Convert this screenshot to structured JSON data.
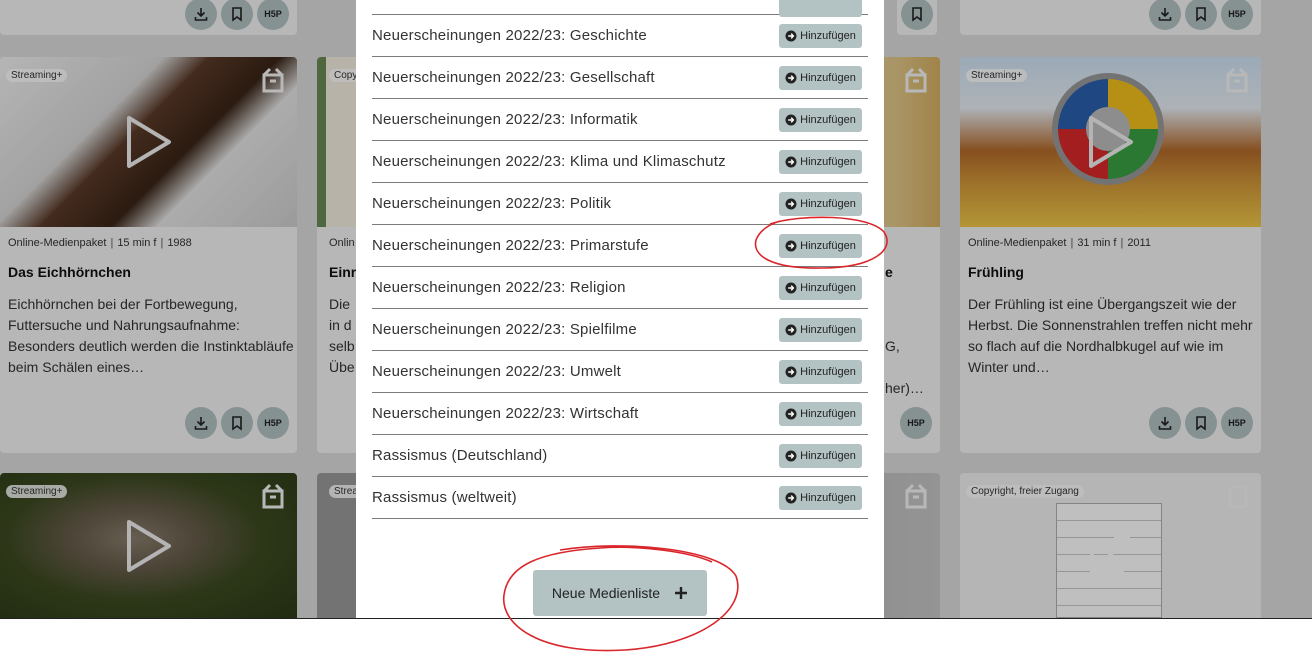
{
  "cards": [
    {
      "badge": "Streaming+",
      "meta": [
        "Online-Medienpaket",
        "15 min f",
        "1988"
      ],
      "title": "Das Eichhörnchen",
      "description": "Eichhörnchen bei der Fortbewegung, Futtersuche und Nahrungsaufnahme: Besonders deutlich werden die Instinktabläufe beim Schälen eines…",
      "actions": [
        "download",
        "bookmark",
        "H5P"
      ]
    },
    {
      "badge": "Copy",
      "meta_start": "Onlin",
      "title_partial": "Einr",
      "desc_partial": [
        "Die",
        "in d",
        "selb",
        "Übe"
      ]
    },
    {
      "title_partial": "e",
      "desc_partial": [
        "G,",
        "her)…"
      ],
      "actions": [
        "H5P"
      ]
    },
    {
      "badge": "Streaming+",
      "meta": [
        "Online-Medienpaket",
        "31 min f",
        "2011"
      ],
      "title": "Frühling",
      "description": "Der Frühling ist eine Übergangszeit wie der Herbst. Die Sonnenstrahlen treffen nicht mehr so flach auf die Nordhalbkugel auf wie im Winter und…",
      "actions": [
        "download",
        "bookmark",
        "H5P"
      ]
    }
  ],
  "bottom_cards": [
    {
      "badge": "Streaming+"
    },
    {
      "badge": "Strea"
    },
    {
      "badge": ""
    },
    {
      "badge": "Copyright, freier Zugang"
    }
  ],
  "modal": {
    "rows": [
      {
        "label": "Neuerscheinungen 2022/23: Geschichte",
        "button": "Hinzufügen"
      },
      {
        "label": "Neuerscheinungen 2022/23: Gesellschaft",
        "button": "Hinzufügen"
      },
      {
        "label": "Neuerscheinungen 2022/23: Informatik",
        "button": "Hinzufügen"
      },
      {
        "label": "Neuerscheinungen 2022/23: Klima und Klimaschutz",
        "button": "Hinzufügen"
      },
      {
        "label": "Neuerscheinungen 2022/23: Politik",
        "button": "Hinzufügen"
      },
      {
        "label": "Neuerscheinungen 2022/23: Primarstufe",
        "button": "Hinzufügen"
      },
      {
        "label": "Neuerscheinungen 2022/23: Religion",
        "button": "Hinzufügen"
      },
      {
        "label": "Neuerscheinungen 2022/23: Spielfilme",
        "button": "Hinzufügen"
      },
      {
        "label": "Neuerscheinungen 2022/23: Umwelt",
        "button": "Hinzufügen"
      },
      {
        "label": "Neuerscheinungen 2022/23: Wirtschaft",
        "button": "Hinzufügen"
      },
      {
        "label": "Rassismus (Deutschland)",
        "button": "Hinzufügen"
      },
      {
        "label": "Rassismus (weltweit)",
        "button": "Hinzufügen"
      }
    ],
    "new_list_label": "Neue Medienliste",
    "new_list_icon": "plus-icon"
  },
  "colors": {
    "button_bg": "#b3c2c3",
    "annotation_red": "#d9262b",
    "divider": "#7c7c7c"
  }
}
